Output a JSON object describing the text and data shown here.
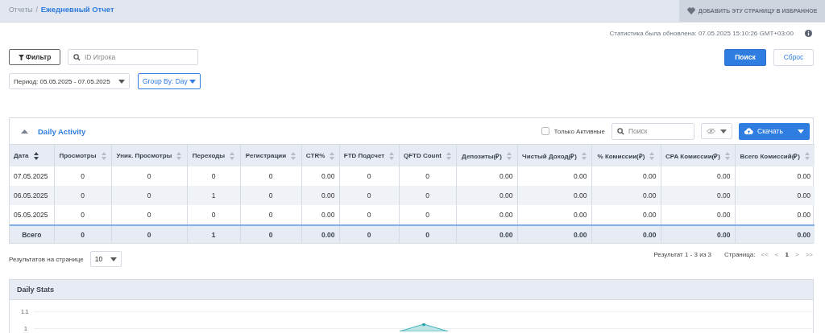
{
  "breadcrumb": {
    "parent": "Отчеты",
    "separator": "/",
    "current": "Ежедневный Отчет"
  },
  "favorite_button": {
    "label": "ДОБАВИТЬ ЭТУ СТРАНИЦУ В ИЗБРАННОЕ"
  },
  "stats_updated": "Статистика была обновлена: 07.05.2025 15:10:26 GMT+03:00",
  "filter_button": {
    "label": "Фильтр"
  },
  "player_id_field": {
    "placeholder": "ID Игрока"
  },
  "search_button": {
    "label": "Поиск"
  },
  "reset_button": {
    "label": "Сброс"
  },
  "period_dropdown": {
    "value": "Период: 05.05.2025 - 07.05.2025"
  },
  "group_by_dropdown": {
    "value": "Group By: Day"
  },
  "daily_activity": {
    "title": "Daily Activity",
    "expanded": true,
    "only_active": {
      "label": "Только Активные",
      "checked": false
    },
    "search_field": {
      "placeholder": "Поиск"
    },
    "download_button": {
      "label": "Скачать"
    },
    "table": {
      "columns": [
        {
          "label": "Дата",
          "kind": "date",
          "sorted": true
        },
        {
          "label": "Просмотры",
          "kind": "count",
          "sorted": false
        },
        {
          "label": "Уник. Просмотры",
          "kind": "count",
          "sorted": false
        },
        {
          "label": "Переходы",
          "kind": "count",
          "sorted": false
        },
        {
          "label": "Регистрации",
          "kind": "count",
          "sorted": false
        },
        {
          "label": "CTR%",
          "kind": "amount",
          "sorted": false
        },
        {
          "label": "FTD Подсчет",
          "kind": "count",
          "sorted": false
        },
        {
          "label": "QFTD Count",
          "kind": "count",
          "sorted": false
        },
        {
          "label": "Депозиты(₽)",
          "kind": "amount",
          "sorted": false
        },
        {
          "label": "Чистый Доход(₽)",
          "kind": "amount",
          "sorted": false
        },
        {
          "label": "% Комиссии(₽)",
          "kind": "amount",
          "sorted": false
        },
        {
          "label": "CPA Комиссии(₽)",
          "kind": "amount",
          "sorted": false
        },
        {
          "label": "Всего Комиссий(₽)",
          "kind": "amount",
          "sorted": false
        }
      ],
      "rows": [
        [
          "07.05.2025",
          "0",
          "0",
          "0",
          "0",
          "0.00",
          "0",
          "0",
          "0.00",
          "0.00",
          "0.00",
          "0.00",
          "0.00"
        ],
        [
          "06.05.2025",
          "0",
          "0",
          "1",
          "0",
          "0.00",
          "0",
          "0",
          "0.00",
          "0.00",
          "0.00",
          "0.00",
          "0.00"
        ],
        [
          "05.05.2025",
          "0",
          "0",
          "0",
          "0",
          "0.00",
          "0",
          "0",
          "0.00",
          "0.00",
          "0.00",
          "0.00",
          "0.00"
        ]
      ],
      "totals": [
        "Всего",
        "0",
        "0",
        "1",
        "0",
        "0.00",
        "0",
        "0",
        "0.00",
        "0.00",
        "0.00",
        "0.00",
        "0.00"
      ]
    },
    "per_page": {
      "label": "Результатов на странице",
      "value": "10"
    },
    "results_summary": "Результат 1 - 3 из 3",
    "pagination": {
      "label": "Страница:",
      "items": [
        {
          "label": "<<",
          "selected": false
        },
        {
          "label": "<",
          "selected": false
        },
        {
          "label": "1",
          "selected": true
        },
        {
          "label": ">",
          "selected": false
        },
        {
          "label": ">>",
          "selected": false
        }
      ]
    }
  },
  "daily_stats": {
    "title": "Daily Stats",
    "y_axis_labels": [
      "1.1",
      "1"
    ]
  }
}
